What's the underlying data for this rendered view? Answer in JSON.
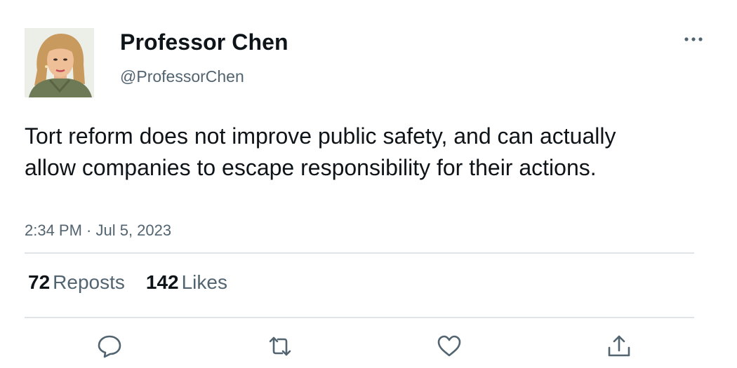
{
  "author": {
    "name": "Professor Chen",
    "handle": "@ProfessorChen"
  },
  "post": {
    "text": "Tort reform does not improve public safety, and can actually allow companies to escape responsibility for their actions.",
    "timestamp": "2:34 PM · Jul 5, 2023"
  },
  "stats": {
    "reposts_count": "72",
    "reposts_label": "Reposts",
    "likes_count": "142",
    "likes_label": "Likes"
  },
  "icons": {
    "more": "more-horizontal-icon",
    "reply": "reply-bubble-icon",
    "repost": "repost-arrows-icon",
    "like": "heart-icon",
    "share": "share-upload-icon"
  },
  "colors": {
    "text_primary": "#0f1419",
    "text_secondary": "#536471",
    "divider": "#e1e4e6"
  }
}
